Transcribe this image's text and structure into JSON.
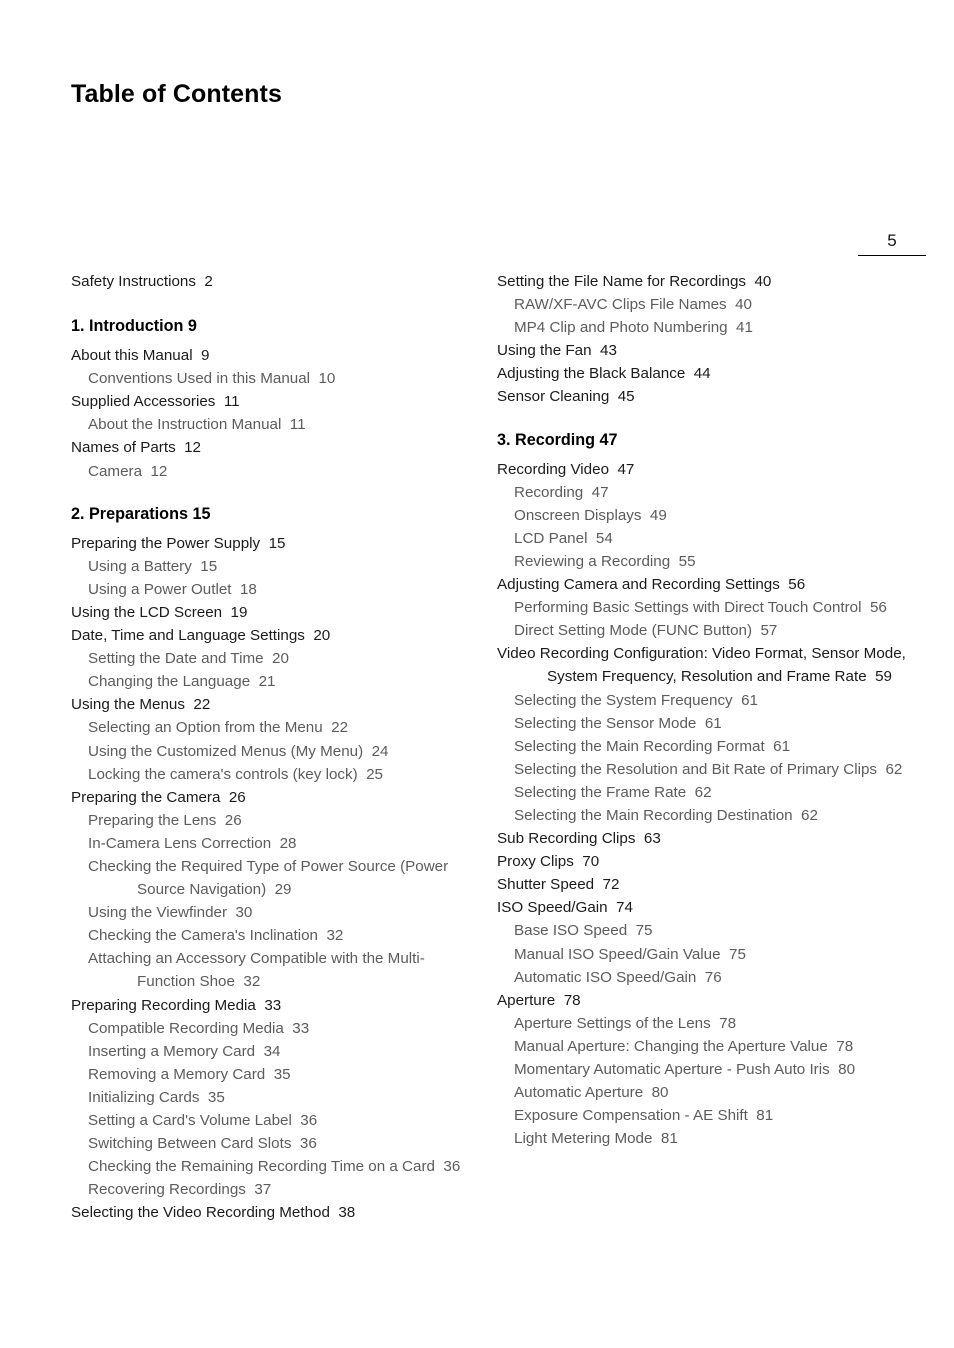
{
  "document": {
    "title": "Table of Contents",
    "folio": "5"
  },
  "left_column": [
    {
      "level": 1,
      "text": "Safety Instructions",
      "page": "2",
      "gap_after": true
    },
    {
      "level": 0,
      "text": "1. Introduction 9"
    },
    {
      "level": 1,
      "text": "About this Manual",
      "page": "9"
    },
    {
      "level": 2,
      "text": "Conventions Used in this Manual",
      "page": "10"
    },
    {
      "level": 1,
      "text": "Supplied Accessories",
      "page": "11"
    },
    {
      "level": 2,
      "text": "About the Instruction Manual",
      "page": "11"
    },
    {
      "level": 1,
      "text": "Names of Parts",
      "page": "12"
    },
    {
      "level": 2,
      "text": "Camera",
      "page": "12"
    },
    {
      "level": 0,
      "text": "2.  Preparations 15"
    },
    {
      "level": 1,
      "text": "Preparing the Power Supply",
      "page": "15"
    },
    {
      "level": 2,
      "text": "Using a Battery",
      "page": "15"
    },
    {
      "level": 2,
      "text": "Using a Power Outlet",
      "page": "18"
    },
    {
      "level": 1,
      "text": "Using the LCD Screen",
      "page": "19"
    },
    {
      "level": 1,
      "text": "Date, Time and Language Settings",
      "page": "20"
    },
    {
      "level": 2,
      "text": "Setting the Date and Time",
      "page": "20"
    },
    {
      "level": 2,
      "text": "Changing the Language",
      "page": "21"
    },
    {
      "level": 1,
      "text": "Using the Menus",
      "page": "22"
    },
    {
      "level": 2,
      "text": "Selecting an Option from the Menu",
      "page": "22"
    },
    {
      "level": 2,
      "text": "Using the Customized Menus (My Menu)",
      "page": "24"
    },
    {
      "level": 2,
      "text": "Locking the camera's controls (key lock)",
      "page": "25"
    },
    {
      "level": 1,
      "text": "Preparing the Camera",
      "page": "26"
    },
    {
      "level": 2,
      "text": "Preparing the Lens",
      "page": "26"
    },
    {
      "level": 2,
      "text": "In-Camera Lens Correction",
      "page": "28"
    },
    {
      "level": 2,
      "text": "Checking the Required Type of Power Source (Power Source Navigation)",
      "page": "29"
    },
    {
      "level": 2,
      "text": "Using the Viewfinder",
      "page": "30"
    },
    {
      "level": 2,
      "text": "Checking the Camera's Inclination",
      "page": "32"
    },
    {
      "level": 2,
      "text": "Attaching an Accessory Compatible with the Multi-Function Shoe",
      "page": "32"
    },
    {
      "level": 1,
      "text": "Preparing Recording Media",
      "page": "33"
    },
    {
      "level": 2,
      "text": "Compatible Recording Media",
      "page": "33"
    },
    {
      "level": 2,
      "text": "Inserting a Memory Card",
      "page": "34"
    },
    {
      "level": 2,
      "text": "Removing a Memory Card",
      "page": "35"
    },
    {
      "level": 2,
      "text": "Initializing Cards",
      "page": "35"
    },
    {
      "level": 2,
      "text": "Setting a Card's Volume Label",
      "page": "36"
    },
    {
      "level": 2,
      "text": "Switching Between Card Slots",
      "page": "36"
    },
    {
      "level": 2,
      "text": "Checking the Remaining Recording Time on a Card",
      "page": "36"
    },
    {
      "level": 2,
      "text": "Recovering Recordings",
      "page": "37"
    },
    {
      "level": 1,
      "text": "Selecting the Video Recording Method",
      "page": "38"
    }
  ],
  "right_column": [
    {
      "level": 1,
      "text": "Setting the File Name for Recordings",
      "page": "40"
    },
    {
      "level": 2,
      "text": "RAW/XF-AVC Clips File Names",
      "page": "40"
    },
    {
      "level": 2,
      "text": "MP4 Clip and Photo Numbering",
      "page": "41"
    },
    {
      "level": 1,
      "text": "Using the Fan",
      "page": "43"
    },
    {
      "level": 1,
      "text": "Adjusting the Black Balance",
      "page": "44"
    },
    {
      "level": 1,
      "text": "Sensor Cleaning",
      "page": "45"
    },
    {
      "level": 0,
      "text": "3. Recording 47"
    },
    {
      "level": 1,
      "text": "Recording Video",
      "page": "47"
    },
    {
      "level": 2,
      "text": "Recording",
      "page": "47"
    },
    {
      "level": 2,
      "text": "Onscreen Displays",
      "page": "49"
    },
    {
      "level": 2,
      "text": "LCD Panel",
      "page": "54"
    },
    {
      "level": 2,
      "text": "Reviewing a Recording",
      "page": "55"
    },
    {
      "level": 1,
      "text": "Adjusting Camera and Recording Settings",
      "page": "56"
    },
    {
      "level": 2,
      "text": "Performing Basic Settings with Direct Touch Control",
      "page": "56"
    },
    {
      "level": 2,
      "text": "Direct Setting Mode (FUNC Button)",
      "page": "57"
    },
    {
      "level": 1,
      "text": "Video Recording Configuration: Video Format, Sensor Mode, System Frequency, Resolution and Frame Rate",
      "page": "59"
    },
    {
      "level": 2,
      "text": "Selecting the System Frequency",
      "page": "61"
    },
    {
      "level": 2,
      "text": "Selecting the Sensor Mode",
      "page": "61"
    },
    {
      "level": 2,
      "text": "Selecting the Main Recording Format",
      "page": "61"
    },
    {
      "level": 2,
      "text": "Selecting the Resolution and Bit Rate of Primary Clips",
      "page": "62"
    },
    {
      "level": 2,
      "text": "Selecting the Frame Rate",
      "page": "62"
    },
    {
      "level": 2,
      "text": "Selecting the Main Recording Destination",
      "page": "62"
    },
    {
      "level": 1,
      "text": "Sub Recording Clips",
      "page": "63"
    },
    {
      "level": 1,
      "text": "Proxy Clips",
      "page": "70"
    },
    {
      "level": 1,
      "text": "Shutter Speed",
      "page": "72"
    },
    {
      "level": 1,
      "text": "ISO Speed/Gain",
      "page": "74"
    },
    {
      "level": 2,
      "text": "Base ISO Speed",
      "page": "75"
    },
    {
      "level": 2,
      "text": "Manual ISO Speed/Gain Value",
      "page": "75"
    },
    {
      "level": 2,
      "text": "Automatic ISO Speed/Gain",
      "page": "76"
    },
    {
      "level": 1,
      "text": "Aperture",
      "page": "78"
    },
    {
      "level": 2,
      "text": "Aperture Settings of the Lens",
      "page": "78"
    },
    {
      "level": 2,
      "text": "Manual Aperture: Changing the Aperture Value",
      "page": "78"
    },
    {
      "level": 2,
      "text": "Momentary Automatic Aperture - Push Auto Iris",
      "page": "80"
    },
    {
      "level": 2,
      "text": "Automatic Aperture",
      "page": "80"
    },
    {
      "level": 2,
      "text": "Exposure Compensation - AE Shift",
      "page": "81"
    },
    {
      "level": 2,
      "text": "Light Metering Mode",
      "page": "81"
    }
  ]
}
